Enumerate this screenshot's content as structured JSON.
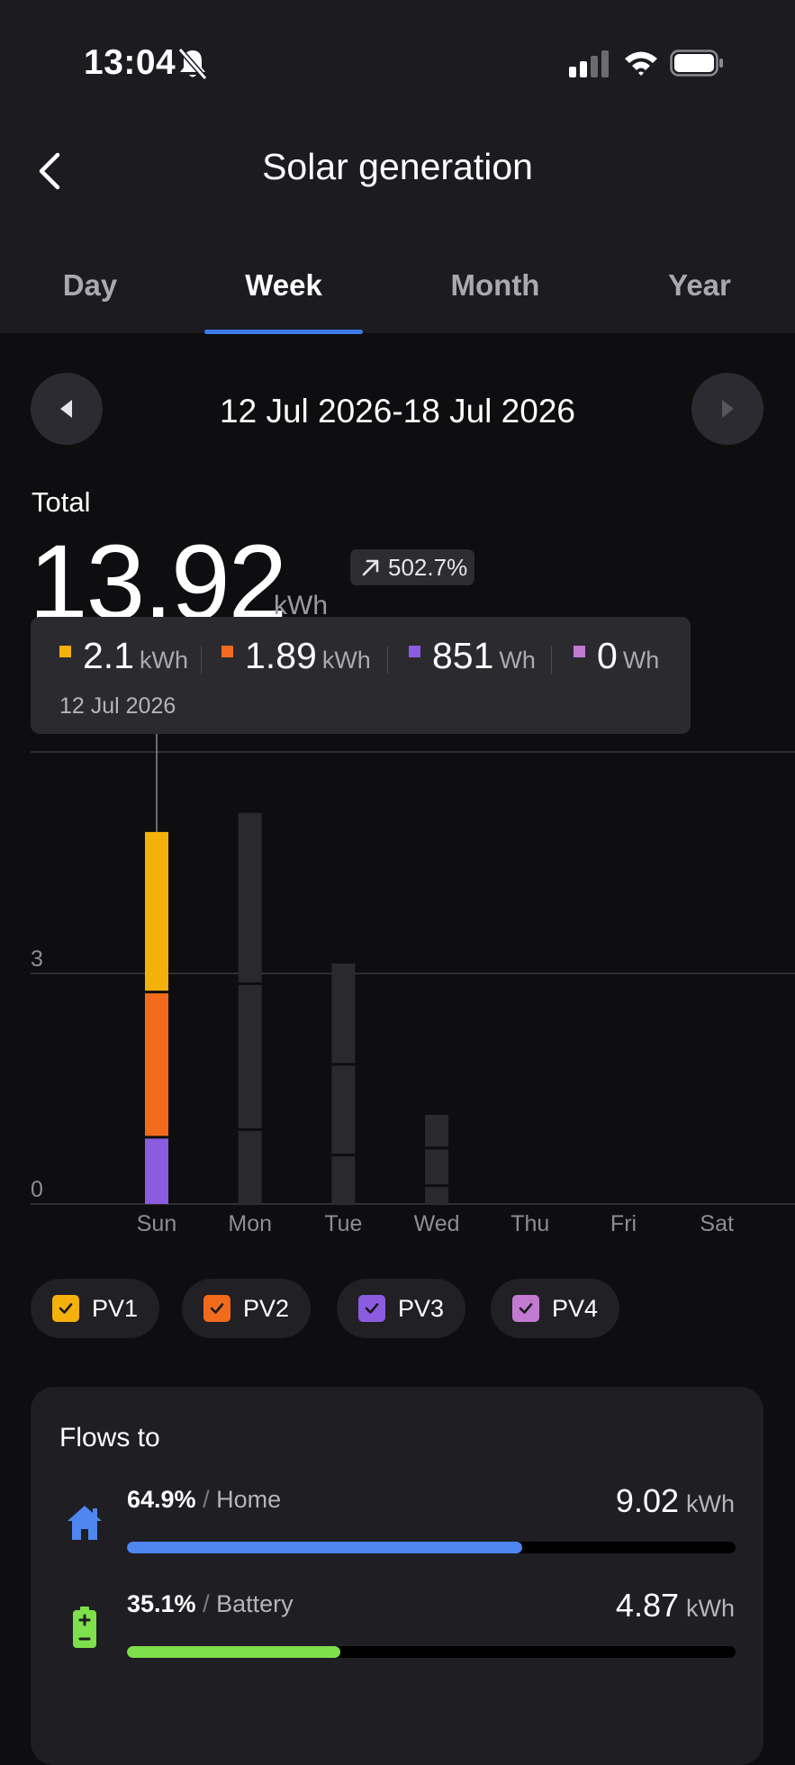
{
  "status_bar": {
    "time": "13:04",
    "icons": [
      "bell-muted-icon",
      "signal-icon",
      "wifi-icon",
      "battery-icon"
    ]
  },
  "header": {
    "title": "Solar generation",
    "back_icon": "chevron-left-icon"
  },
  "tabs": [
    {
      "label": "Day",
      "active": false
    },
    {
      "label": "Week",
      "active": true
    },
    {
      "label": "Month",
      "active": false
    },
    {
      "label": "Year",
      "active": false
    }
  ],
  "date_range": {
    "label": "12 Jul 2026-18 Jul 2026",
    "prev_icon": "triangle-left-icon",
    "next_icon": "triangle-right-icon"
  },
  "total": {
    "label": "Total",
    "value": "13.92",
    "unit": "kWh",
    "change": "502.7%",
    "change_icon": "arrow-up-right-icon"
  },
  "tooltip": {
    "date": "12 Jul 2026",
    "items": [
      {
        "value": "2.1",
        "unit": "kWh",
        "color": "#f4b10b"
      },
      {
        "value": "1.89",
        "unit": "kWh",
        "color": "#f26b1d"
      },
      {
        "value": "851",
        "unit": "Wh",
        "color": "#8b5ce0"
      },
      {
        "value": "0",
        "unit": "Wh",
        "color": "#c27ad1"
      }
    ]
  },
  "chart_data": {
    "type": "bar",
    "stacked": true,
    "categories": [
      "Sun",
      "Mon",
      "Tue",
      "Wed",
      "Thu",
      "Fri",
      "Sat"
    ],
    "y_ticks": [
      "0",
      "3"
    ],
    "ylim": [
      0,
      6
    ],
    "selected_category": "Sun",
    "series": [
      {
        "name": "PV3",
        "color": "#8b5ce0",
        "values": [
          0.851,
          0.95,
          0.62,
          0.22,
          0,
          0,
          0
        ]
      },
      {
        "name": "PV2",
        "color": "#f26b1d",
        "values": [
          1.89,
          1.9,
          1.18,
          0.49,
          0,
          0,
          0
        ]
      },
      {
        "name": "PV1",
        "color": "#f4b10b",
        "values": [
          2.1,
          2.24,
          1.33,
          0.45,
          0,
          0,
          0
        ]
      },
      {
        "name": "PV4",
        "color": "#c27ad1",
        "values": [
          0,
          0,
          0,
          0,
          0,
          0,
          0
        ]
      }
    ],
    "inactive_color": "#2a2a2e",
    "gridlines": true
  },
  "legend": [
    {
      "label": "PV1",
      "color": "#f4b10b",
      "checked": true
    },
    {
      "label": "PV2",
      "color": "#f26b1d",
      "checked": true
    },
    {
      "label": "PV3",
      "color": "#8b5ce0",
      "checked": true
    },
    {
      "label": "PV4",
      "color": "#c27ad1",
      "checked": true
    }
  ],
  "flows": {
    "title": "Flows to",
    "items": [
      {
        "percent": "64.9%",
        "separator": "/",
        "name": "Home",
        "value": "9.02",
        "unit": "kWh",
        "fraction": 0.649,
        "color": "#4f86f0",
        "icon": "home-icon"
      },
      {
        "percent": "35.1%",
        "separator": "/",
        "name": "Battery",
        "value": "4.87",
        "unit": "kWh",
        "fraction": 0.351,
        "color": "#7ee04a",
        "icon": "battery-charge-icon"
      }
    ]
  }
}
